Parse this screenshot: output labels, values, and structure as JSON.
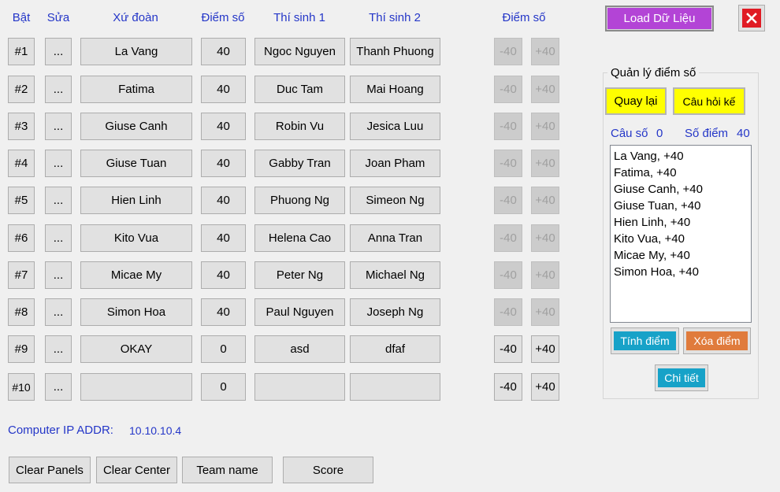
{
  "headers": {
    "bat": "Bật",
    "sua": "Sửa",
    "xu_doan": "Xứ đoàn",
    "diem_so": "Điểm số",
    "thi_sinh_1": "Thí sinh 1",
    "thi_sinh_2": "Thí sinh 2",
    "diem_so_right": "Điểm số"
  },
  "rows": [
    {
      "id": "#1",
      "edit": "...",
      "team": "La Vang",
      "score": "40",
      "c1": "Ngoc Nguyen",
      "c2": "Thanh Phuong",
      "minus": "-40",
      "plus": "+40",
      "enabled": false
    },
    {
      "id": "#2",
      "edit": "...",
      "team": "Fatima",
      "score": "40",
      "c1": "Duc Tam",
      "c2": "Mai Hoang",
      "minus": "-40",
      "plus": "+40",
      "enabled": false
    },
    {
      "id": "#3",
      "edit": "...",
      "team": "Giuse Canh",
      "score": "40",
      "c1": "Robin Vu",
      "c2": "Jesica Luu",
      "minus": "-40",
      "plus": "+40",
      "enabled": false
    },
    {
      "id": "#4",
      "edit": "...",
      "team": "Giuse Tuan",
      "score": "40",
      "c1": "Gabby Tran",
      "c2": "Joan Pham",
      "minus": "-40",
      "plus": "+40",
      "enabled": false
    },
    {
      "id": "#5",
      "edit": "...",
      "team": "Hien Linh",
      "score": "40",
      "c1": "Phuong Ng",
      "c2": "Simeon Ng",
      "minus": "-40",
      "plus": "+40",
      "enabled": false
    },
    {
      "id": "#6",
      "edit": "...",
      "team": "Kito Vua",
      "score": "40",
      "c1": "Helena Cao",
      "c2": "Anna Tran",
      "minus": "-40",
      "plus": "+40",
      "enabled": false
    },
    {
      "id": "#7",
      "edit": "...",
      "team": "Micae My",
      "score": "40",
      "c1": "Peter Ng",
      "c2": "Michael Ng",
      "minus": "-40",
      "plus": "+40",
      "enabled": false
    },
    {
      "id": "#8",
      "edit": "...",
      "team": "Simon Hoa",
      "score": "40",
      "c1": "Paul Nguyen",
      "c2": "Joseph Ng",
      "minus": "-40",
      "plus": "+40",
      "enabled": false
    },
    {
      "id": "#9",
      "edit": "...",
      "team": "OKAY",
      "score": "0",
      "c1": "asd",
      "c2": "dfaf",
      "minus": "-40",
      "plus": "+40",
      "enabled": true
    },
    {
      "id": "#10",
      "edit": "...",
      "team": "",
      "score": "0",
      "c1": "",
      "c2": "",
      "minus": "-40",
      "plus": "+40",
      "enabled": true
    }
  ],
  "top": {
    "load_label": "Load Dữ Liệu",
    "close_icon": "close-icon"
  },
  "manager": {
    "title": "Quản lý điểm số",
    "back_label": "Quay lại",
    "next_label": "Câu hỏi kế",
    "question_label": "Câu số",
    "question_value": "0",
    "points_label": "Số điểm",
    "points_value": "40",
    "list": [
      "La Vang,  +40",
      "Fatima,  +40",
      "Giuse Canh,  +40",
      "Giuse Tuan,  +40",
      "Hien Linh,  +40",
      "Kito Vua,  +40",
      "Micae My,  +40",
      "Simon Hoa,  +40"
    ],
    "calc_label": "Tính điểm",
    "clear_label": "Xóa điểm",
    "detail_label": "Chi tiết"
  },
  "footer": {
    "ip_label": "Computer IP ADDR:",
    "ip_value": "10.10.10.4",
    "clear_panels": "Clear Panels",
    "clear_center": "Clear Center",
    "team_name": "Team name",
    "score": "Score"
  },
  "colors": {
    "header_blue": "#2436c8",
    "load_purple": "#b344d6",
    "yellow": "#ffff00",
    "teal": "#17a2c8",
    "orange": "#e07b3c",
    "close_red": "#e01b24"
  }
}
